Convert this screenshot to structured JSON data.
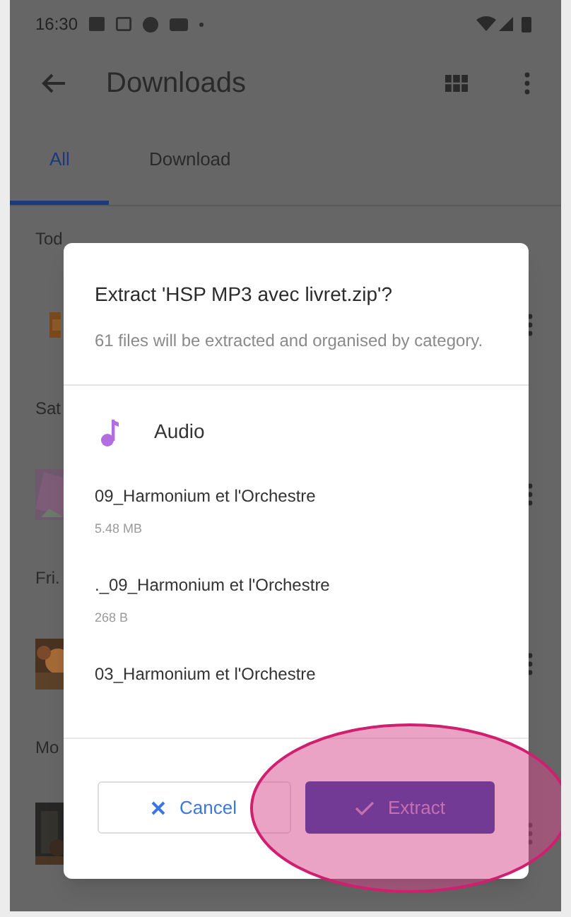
{
  "status_bar": {
    "time": "16:30"
  },
  "app_bar": {
    "title": "Downloads"
  },
  "tabs": [
    {
      "label": "All",
      "selected": true
    },
    {
      "label": "Download",
      "selected": false
    }
  ],
  "sections": [
    {
      "label": "Tod"
    },
    {
      "label": "Sat"
    },
    {
      "label": "Fri."
    },
    {
      "label": "Mo"
    }
  ],
  "dialog": {
    "title": "Extract 'HSP MP3 avec livret.zip'?",
    "message": "61 files will be extracted and organised by category.",
    "category": "Audio",
    "files": [
      {
        "name": "09_Harmonium et l'Orchestre",
        "size": "5.48 MB"
      },
      {
        "name": "._09_Harmonium et l'Orchestre",
        "size": "268 B"
      },
      {
        "name": "03_Harmonium et l'Orchestre"
      }
    ],
    "buttons": [
      {
        "kind": "cancel",
        "label": "Cancel"
      },
      {
        "kind": "confirm",
        "label": "Extract"
      }
    ]
  }
}
